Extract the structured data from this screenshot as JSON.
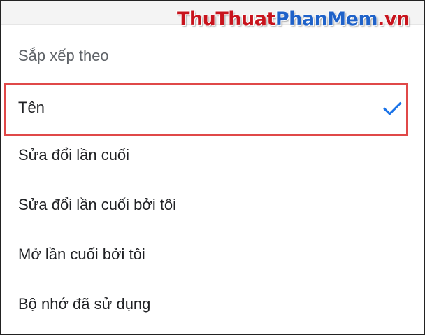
{
  "watermark": {
    "part_red": "ThuThuat",
    "part_blue": "PhanMem",
    "part_red2": ".vn"
  },
  "sheet": {
    "title": "Sắp xếp theo",
    "options": [
      {
        "label": "Tên",
        "selected": true
      },
      {
        "label": "Sửa đổi lần cuối",
        "selected": false
      },
      {
        "label": "Sửa đổi lần cuối bởi tôi",
        "selected": false
      },
      {
        "label": "Mở lần cuối bởi tôi",
        "selected": false
      },
      {
        "label": "Bộ nhớ đã sử dụng",
        "selected": false
      }
    ]
  },
  "icons": {
    "selected_indicator": "checkmark-icon"
  },
  "colors": {
    "accent": "#1a73e8",
    "highlight_border": "#e04848",
    "title_text": "#5f6368",
    "option_text": "#202124"
  }
}
